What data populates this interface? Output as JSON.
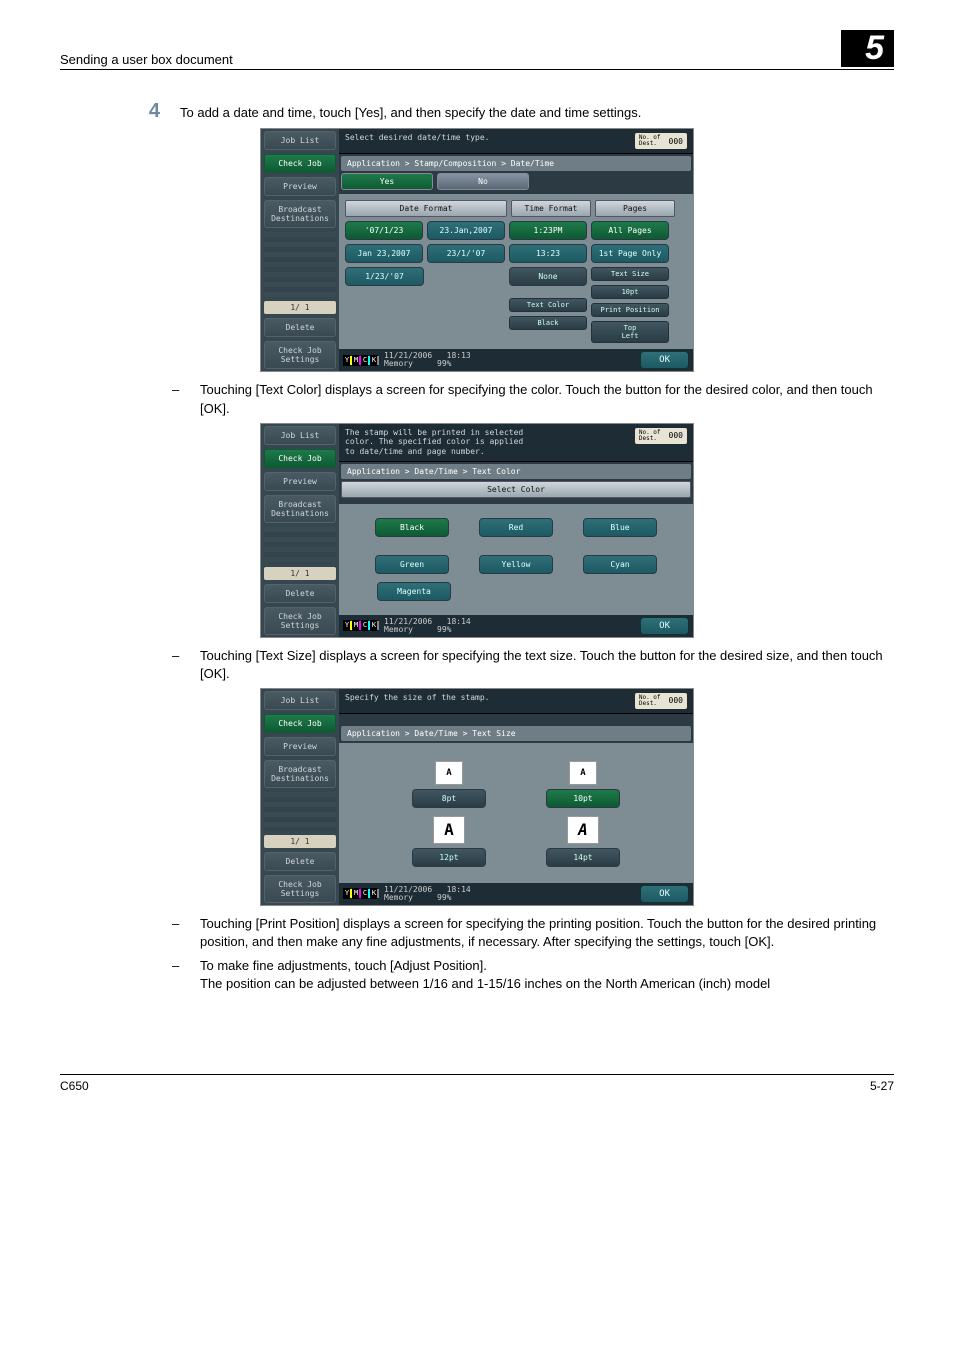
{
  "running_head": {
    "left": "Sending a user box document",
    "right": "5"
  },
  "step4": {
    "num": "4",
    "text": "To add a date and time, touch [Yes], and then specify the date and time settings."
  },
  "bullets": {
    "b1": "Touching [Text Color] displays a screen for specifying the color. Touch the button for the desired color, and then touch [OK].",
    "b2": "Touching [Text Size] displays a screen for specifying the text size. Touch the button for the desired size, and then touch [OK].",
    "b3": "Touching [Print Position] displays a screen for specifying the printing position. Touch the button for the desired printing position, and then make any fine adjustments, if necessary. After specifying the settings, touch [OK].",
    "b4": "To make fine adjustments, touch [Adjust Position].",
    "b4b": "The position can be adjusted between 1/16 and 1-15/16 inches on the North American (inch) model"
  },
  "side": {
    "job_list": "Job List",
    "check_job": "Check Job",
    "preview": "Preview",
    "broadcast": "Broadcast\nDestinations",
    "page": "1/  1",
    "delete": "Delete",
    "check_settings": "Check Job\nSettings"
  },
  "dest": {
    "label": "No. of\nDest.",
    "count": "000"
  },
  "footer_common": {
    "memory_label": "Memory",
    "memory_val": "99%",
    "ok": "OK",
    "toners": [
      "Y",
      "M",
      "C",
      "K"
    ]
  },
  "panel1": {
    "msg": "Select desired date/time type.",
    "crumb": "Application > Stamp/Composition > Date/Time",
    "yes": "Yes",
    "no": "No",
    "headers": {
      "date": "Date Format",
      "time": "Time Format",
      "pages": "Pages"
    },
    "date_buttons": [
      "'07/1/23",
      "23.Jan,2007",
      "Jan 23,2007",
      "23/1/'07",
      "1/23/'07"
    ],
    "time_buttons": [
      "1:23PM",
      "13:23",
      "None"
    ],
    "pages_buttons": [
      "All Pages",
      "1st Page Only"
    ],
    "textcolor_label": "Text Color",
    "textcolor_val": "Black",
    "textsize_label": "Text Size",
    "textsize_val": "10pt",
    "printpos_label": "Print Position",
    "printpos_val": "Top\nLeft",
    "date": "11/21/2006",
    "time": "18:13"
  },
  "panel2": {
    "msg": "The stamp will be printed in selected\ncolor. The specified color is applied\nto date/time and page number.",
    "crumb": "Application > Date/Time > Text Color",
    "subhead": "Select Color",
    "colors": [
      "Black",
      "Red",
      "Blue",
      "Green",
      "Yellow",
      "Cyan",
      "Magenta"
    ],
    "date": "11/21/2006",
    "time": "18:14"
  },
  "panel3": {
    "msg": "Specify the size of the stamp.",
    "crumb": "Application > Date/Time > Text Size",
    "sizes": [
      {
        "glyph": "A",
        "label": "8pt",
        "big": false
      },
      {
        "glyph": "A",
        "label": "10pt",
        "big": false
      },
      {
        "glyph": "A",
        "label": "12pt",
        "big": true
      },
      {
        "glyph": "A",
        "label": "14pt",
        "big": true
      }
    ],
    "date": "11/21/2006",
    "time": "18:14"
  },
  "page_foot": {
    "left": "C650",
    "right": "5-27"
  }
}
